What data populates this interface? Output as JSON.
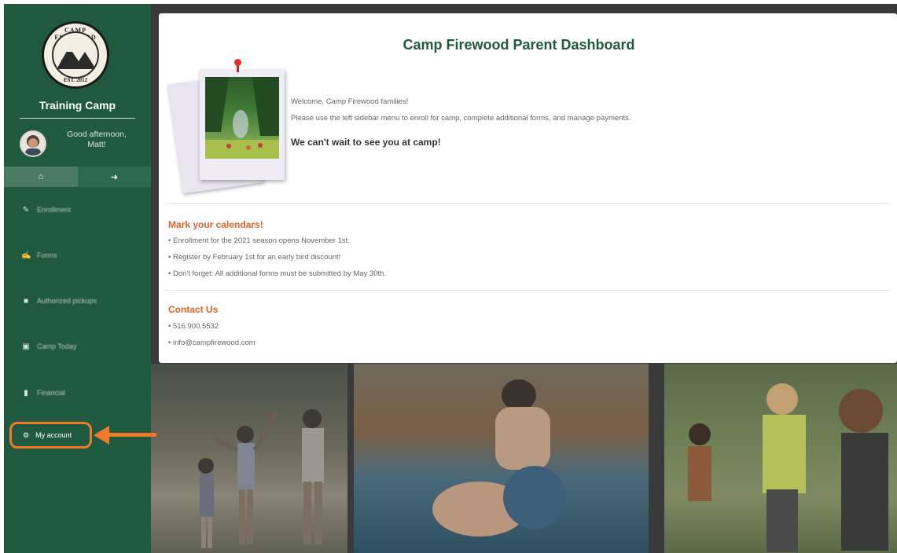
{
  "sidebar": {
    "logo": {
      "ring_text": "CAMP FIREWOOD",
      "est": "EST. 2012"
    },
    "camp_name": "Training Camp",
    "greeting": "Good afternoon, Matt!",
    "icons": {
      "home": "home-icon",
      "logout": "sign-out-icon"
    },
    "nav": [
      {
        "label": "Enrollment",
        "icon": "pencil-icon"
      },
      {
        "label": "Forms",
        "icon": "edit-icon"
      },
      {
        "label": "Authorized pickups",
        "icon": "users-icon"
      },
      {
        "label": "Camp Today",
        "icon": "image-icon"
      },
      {
        "label": "Financial",
        "icon": "file-icon"
      }
    ],
    "my_account": {
      "label": "My account",
      "icon": "gear-icon"
    }
  },
  "dashboard": {
    "title": "Camp Firewood Parent Dashboard",
    "welcome_line1": "Welcome, Camp Firewood families!",
    "welcome_line2": "Please use the left sidebar menu to enroll for camp, complete additional forms, and manage payments.",
    "welcome_line3": "We can't wait to see you at camp!",
    "calendar": {
      "title": "Mark your calendars!",
      "items": [
        "• Enrollment for the 2021 season opens November 1st.",
        "• Register by February 1st for an early bird discount!",
        "• Don't forget: All additional forms must be submitted by May 30th."
      ]
    },
    "contact": {
      "title": "Contact Us",
      "items": [
        "• 516.900.5532",
        "• info@campfirewood.com"
      ]
    }
  },
  "colors": {
    "sidebar": "#1f5a3f",
    "title": "#1f5a3f",
    "section_title": "#e0642a",
    "highlight": "#f07a2a"
  }
}
